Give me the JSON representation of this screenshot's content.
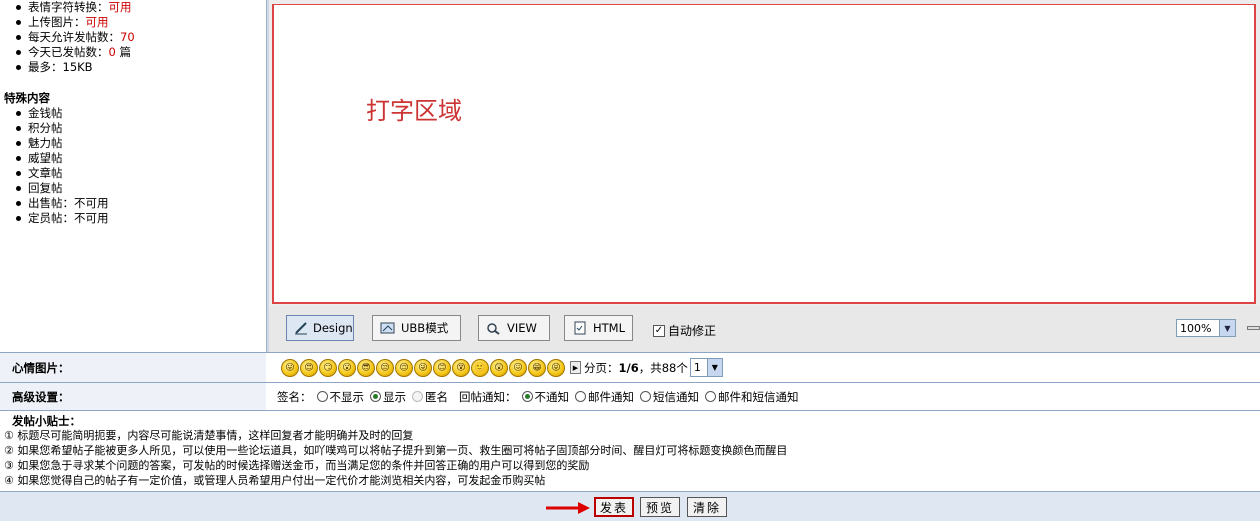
{
  "left_panel": {
    "permissions": [
      {
        "label": "表情字符转换：",
        "value": "可用",
        "suffix": ""
      },
      {
        "label": "上传图片：",
        "value": "可用",
        "suffix": ""
      },
      {
        "label": "每天允许发帖数：",
        "value": "70",
        "suffix": ""
      },
      {
        "label": "今天已发帖数：",
        "value": "0",
        "suffix": " 篇"
      },
      {
        "label": "最多：15KB",
        "value": "",
        "suffix": ""
      }
    ],
    "special_title": "特殊内容",
    "special_items": [
      "金钱帖",
      "积分帖",
      "魅力帖",
      "威望帖",
      "文章帖",
      "回复帖",
      "出售帖：不可用",
      "定员帖：不可用"
    ]
  },
  "editor": {
    "placeholder_text": "打字区域",
    "modes": [
      {
        "label": "Design",
        "icon": "design-icon"
      },
      {
        "label": "UBB模式",
        "icon": "ubb-icon"
      },
      {
        "label": "VIEW",
        "icon": "view-icon"
      },
      {
        "label": "HTML",
        "icon": "html-icon"
      }
    ],
    "autofix_label": "自动修正",
    "autofix_checked": true,
    "zoom": "100%"
  },
  "mood": {
    "label": "心情图片：",
    "emoticons": [
      "😛",
      "😍",
      "😏",
      "😮",
      "😎",
      "😒",
      "😌",
      "😜",
      "😊",
      "😵",
      "🙂",
      "😲",
      "😖",
      "😁",
      "😝"
    ],
    "page_text_prefix": "分页：",
    "page_current": "1/6",
    "page_total_text": "，共88个",
    "page_select": "1"
  },
  "advanced": {
    "label": "高级设置：",
    "sign_label": "签名：",
    "sign_options": [
      {
        "label": "不显示",
        "state": "off"
      },
      {
        "label": "显示",
        "state": "on"
      },
      {
        "label": "匿名",
        "state": "disabled"
      }
    ],
    "notify_label": "回帖通知：",
    "notify_options": [
      {
        "label": "不通知",
        "state": "on"
      },
      {
        "label": "邮件通知",
        "state": "off"
      },
      {
        "label": "短信通知",
        "state": "off"
      },
      {
        "label": "邮件和短信通知",
        "state": "off"
      }
    ]
  },
  "tips": {
    "title": "发帖小贴士：",
    "lines": [
      "① 标题尽可能简明扼要，内容尽可能说清楚事情，这样回复者才能明确并及时的回复",
      "② 如果您希望帖子能被更多人所见，可以使用一些论坛道具，如吖噗鸡可以将帖子提升到第一页、救生圈可将帖子固顶部分时间、醒目灯可将标题变换颜色而醒目",
      "③ 如果您急于寻求某个问题的答案，可发帖的时候选择赠送金币，而当满足您的条件并回答正确的用户可以得到您的奖励",
      "④ 如果您觉得自己的帖子有一定价值，或管理人员希望用户付出一定代价才能浏览相关内容，可发起金币购买帖"
    ]
  },
  "actions": {
    "submit": "发表",
    "preview": "预览",
    "clear": "清除"
  },
  "colors": {
    "accent_red": "#cc0000",
    "row_border": "#8fa5c6"
  }
}
